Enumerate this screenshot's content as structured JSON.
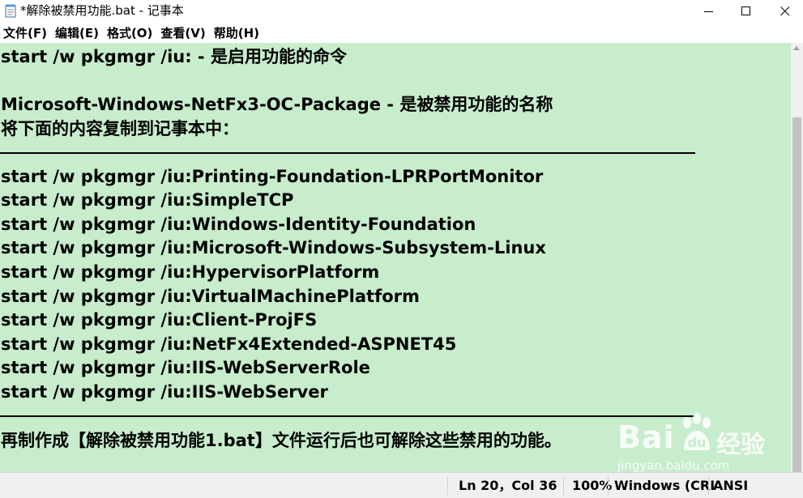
{
  "window": {
    "title": "*解除被禁用功能.bat - 记事本",
    "icon": "notepad-icon",
    "minimize_icon": "minimize-icon",
    "maximize_icon": "maximize-icon",
    "close_icon": "close-icon"
  },
  "menu": [
    {
      "label": "文件(F)"
    },
    {
      "label": "编辑(E)"
    },
    {
      "label": "格式(O)"
    },
    {
      "label": "查看(V)"
    },
    {
      "label": "帮助(H)"
    }
  ],
  "editor": {
    "background": "#c7edcc",
    "lines": [
      "start /w pkgmgr /iu: - 是启用功能的命令",
      "",
      "Microsoft-Windows-NetFx3-OC-Package - 是被禁用功能的名称",
      "将下面的内容复制到记事本中：",
      "",
      "",
      "start /w pkgmgr /iu:Printing-Foundation-LPRPortMonitor",
      "start /w pkgmgr /iu:SimpleTCP",
      "start /w pkgmgr /iu:Windows-Identity-Foundation",
      "start /w pkgmgr /iu:Microsoft-Windows-Subsystem-Linux",
      "start /w pkgmgr /iu:HypervisorPlatform",
      "start /w pkgmgr /iu:VirtualMachinePlatform",
      "start /w pkgmgr /iu:Client-ProjFS",
      "start /w pkgmgr /iu:NetFx4Extended-ASPNET45",
      "start /w pkgmgr /iu:IIS-WebServerRole",
      "start /w pkgmgr /iu:IIS-WebServer",
      "",
      "再制作成【解除被禁用功能1.bat】文件运行后也可解除这些禁用的功能。"
    ]
  },
  "status": {
    "position": "Ln 20，Col 36",
    "zoom": "100%",
    "line_ending": "Windows (CRI",
    "encoding": "ANSI"
  },
  "watermark": {
    "brand": "Bai",
    "brand_cn": "经验",
    "url": "jingyan.baidu.com"
  }
}
